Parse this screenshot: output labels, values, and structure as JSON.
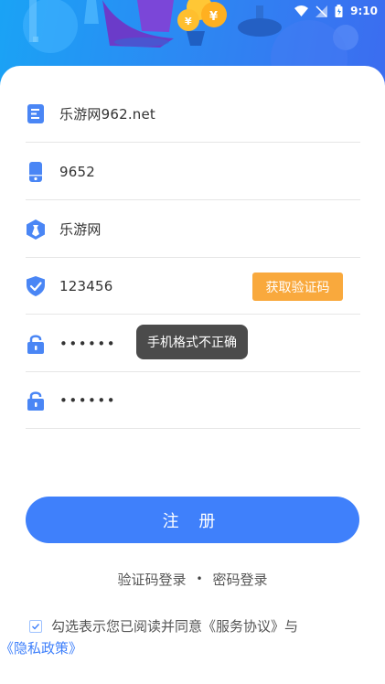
{
  "status_bar": {
    "time": "9:10"
  },
  "form": {
    "fields": [
      {
        "name": "site",
        "value": "乐游网962.net",
        "icon": "document-icon"
      },
      {
        "name": "phone",
        "value": "9652",
        "icon": "phone-icon"
      },
      {
        "name": "nickname",
        "value": "乐游网",
        "icon": "user-badge-icon"
      },
      {
        "name": "verify_code",
        "value": "123456",
        "icon": "shield-check-icon"
      },
      {
        "name": "password",
        "value": "••••••",
        "icon": "lock-icon"
      },
      {
        "name": "confirm_password",
        "value": "••••••",
        "icon": "lock-icon"
      }
    ],
    "get_code_label": "获取验证码"
  },
  "toast": "手机格式不正确",
  "register_label": "注 册",
  "alt_login": {
    "sms": "验证码登录",
    "separator": "•",
    "password": "密码登录"
  },
  "agreement": {
    "prefix": "勾选表示您已阅读并同意",
    "service": "《服务协议》",
    "and": "与",
    "privacy": "《隐私政策》",
    "checked": true
  },
  "colors": {
    "accent": "#3f80fb",
    "code_button": "#f9a93d",
    "banner": "#2b8af3"
  }
}
